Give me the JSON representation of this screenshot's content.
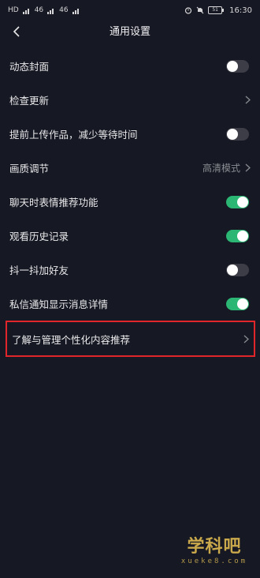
{
  "status_bar": {
    "left_badges": [
      "HD",
      "46",
      "46"
    ],
    "battery": "51",
    "time": "16:30"
  },
  "header": {
    "title": "通用设置"
  },
  "settings": [
    {
      "label": "动态封面",
      "control": "toggle",
      "on": false
    },
    {
      "label": "检查更新",
      "control": "chevron"
    },
    {
      "label": "提前上传作品，减少等待时间",
      "control": "toggle",
      "on": false
    },
    {
      "label": "画质调节",
      "control": "chevron",
      "value": "高清模式"
    },
    {
      "label": "聊天时表情推荐功能",
      "control": "toggle",
      "on": true
    },
    {
      "label": "观看历史记录",
      "control": "toggle",
      "on": true
    },
    {
      "label": "抖一抖加好友",
      "control": "toggle",
      "on": false
    },
    {
      "label": "私信通知显示消息详情",
      "control": "toggle",
      "on": true
    },
    {
      "label": "了解与管理个性化内容推荐",
      "control": "chevron",
      "highlighted": true
    }
  ],
  "colors": {
    "background": "#161823",
    "toggle_on": "#2bb673",
    "toggle_off": "#3c3d46",
    "highlight_border": "#e0262b"
  },
  "icons": [
    "back-arrow-icon",
    "chevron-right-icon",
    "alarm-icon",
    "mute-icon",
    "battery-icon",
    "signal-icon"
  ],
  "watermark": {
    "main": "学科吧",
    "sub": "xueke8.com"
  }
}
